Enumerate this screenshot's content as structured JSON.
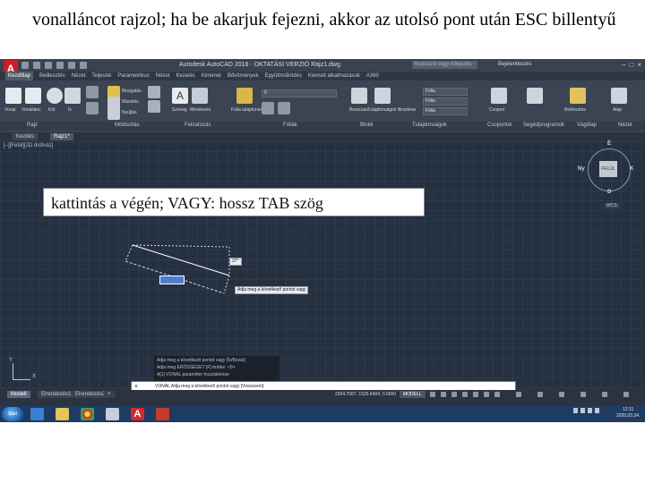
{
  "caption": "vonalláncot rajzol; ha be akarjuk fejezni, akkor az utolsó pont után ESC billentyű",
  "app": {
    "logo": "A",
    "window_title": "Autodesk AutoCAD 2018 - OKTATÁSI VERZIÓ     Rajz1.dwg",
    "search_placeholder": "Kulcsszó vagy kifejezés",
    "login": "Bejelentkezés",
    "window_buttons": [
      "–",
      "□",
      "×"
    ]
  },
  "ribbon_tabs": [
    "Kezdőlap",
    "Beillesztés",
    "Nézet",
    "Teljesíté",
    "Parametrikus",
    "Nézet",
    "Kezelés",
    "Kimenet",
    "Bővítmények",
    "Együttműködés",
    "Kiemelt alkalmazások",
    "A360"
  ],
  "ribbon_panels": [
    {
      "label": "Rajz"
    },
    {
      "label": "Módosítás"
    },
    {
      "label": "Feliratozás"
    },
    {
      "label": "Fóliák"
    },
    {
      "label": "Blokk"
    },
    {
      "label": "Tulajdonságok"
    },
    {
      "label": "Csoportok"
    },
    {
      "label": "Segédprogramok"
    },
    {
      "label": "Vágólap"
    },
    {
      "label": "Nézet"
    }
  ],
  "ribbon_items": {
    "vonal": "Vonal",
    "vonallanc": "Vonallánc",
    "kor": "Kör",
    "iv": "Ív",
    "mozgatas": "Mozgatás",
    "masolas": "Másolás",
    "nyujtas": "Nyújtás",
    "szoveg": "Szöveg",
    "meretezes": "Méretezés",
    "folia_tul": "Fólia tulajdonságok",
    "beszuras": "Beszúrás",
    "tul_illesztes": "Tulajdonságok illesztése",
    "csoport": "Csoport",
    "segedprog": "Segédprogramok",
    "beillesztes": "Beillesztés",
    "alap": "Alap",
    "folia_combo": "Fólia",
    "0": "0"
  },
  "doc_tabs": [
    "Kezdés",
    "Rajz1*"
  ],
  "view_label": "[–][Felül][2D drótváz]",
  "viewcube": {
    "face": "FELÜL",
    "n": "É",
    "s": "D",
    "e": "K",
    "w": "Ny",
    "wcs": "WCS"
  },
  "tooltip_overlay": "kattintás a végén; VAGY: hossz TAB szög",
  "dynamic_input": {
    "angle": "37°",
    "prompt": "Adja meg a következő pontot vagy"
  },
  "ucs": {
    "y": "Y",
    "x": "X"
  },
  "command_history": [
    "Adja meg a következő pontot vagy [Ív/Bezár]",
    "Adja meg ERŐSSÉGET [F] értéke: <0>",
    "A[1] VONAL paraméter hozzákérése"
  ],
  "command_line": "VONAL Adja meg a következő pontot vagy [Visszavon]:",
  "layout_tabs": [
    "Modell",
    "Elrendezés1",
    "Elrendezés2",
    "+"
  ],
  "status": {
    "coords": "2204.7067, 1525.6404, 0.0000",
    "model": "MODELL"
  },
  "taskbar": {
    "start": "Start",
    "time": "12:11",
    "date": "2020.03.24."
  }
}
